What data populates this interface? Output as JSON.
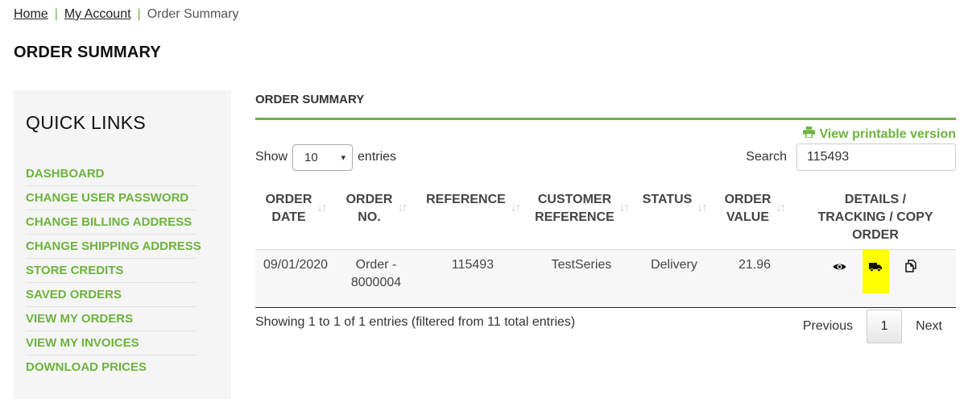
{
  "breadcrumb": {
    "home": "Home",
    "account": "My Account",
    "current": "Order Summary",
    "sep": "|"
  },
  "page_title": "ORDER SUMMARY",
  "sidebar": {
    "title": "QUICK LINKS",
    "items": [
      {
        "label": "DASHBOARD"
      },
      {
        "label": "CHANGE USER PASSWORD"
      },
      {
        "label": "CHANGE BILLING ADDRESS"
      },
      {
        "label": "CHANGE SHIPPING ADDRESS"
      },
      {
        "label": "STORE CREDITS"
      },
      {
        "label": "SAVED ORDERS"
      },
      {
        "label": "VIEW MY ORDERS"
      },
      {
        "label": "VIEW MY INVOICES"
      },
      {
        "label": "DOWNLOAD PRICES"
      }
    ]
  },
  "main": {
    "section_title": "ORDER SUMMARY",
    "print_label": "View printable version",
    "show_label": "Show",
    "entries_label": "entries",
    "page_size": "10",
    "search_label": "Search",
    "search_value": "115493",
    "columns": [
      {
        "line1": "ORDER",
        "line2": "DATE"
      },
      {
        "line1": "ORDER",
        "line2": "NO."
      },
      {
        "line1": "REFERENCE",
        "line2": ""
      },
      {
        "line1": "CUSTOMER",
        "line2": "REFERENCE"
      },
      {
        "line1": "STATUS",
        "line2": ""
      },
      {
        "line1": "ORDER",
        "line2": "VALUE"
      },
      {
        "line1": "DETAILS /",
        "line2": "TRACKING / COPY",
        "line3": "ORDER"
      }
    ],
    "rows": [
      {
        "date": "09/01/2020",
        "order_no_1": "Order -",
        "order_no_2": "8000004",
        "reference": "115493",
        "customer_reference": "TestSeries",
        "status": "Delivery",
        "value": "21.96"
      }
    ],
    "info": "Showing 1 to 1 of 1 entries (filtered from 11 total entries)",
    "pager": {
      "previous": "Previous",
      "page": "1",
      "next": "Next"
    }
  },
  "colors": {
    "accent": "#6db33f",
    "highlight": "#ffff00"
  },
  "icons": {
    "details": "eye-icon",
    "tracking": "truck-icon",
    "copy": "copy-icon",
    "print": "printer-icon",
    "sort": "sort-icon"
  }
}
